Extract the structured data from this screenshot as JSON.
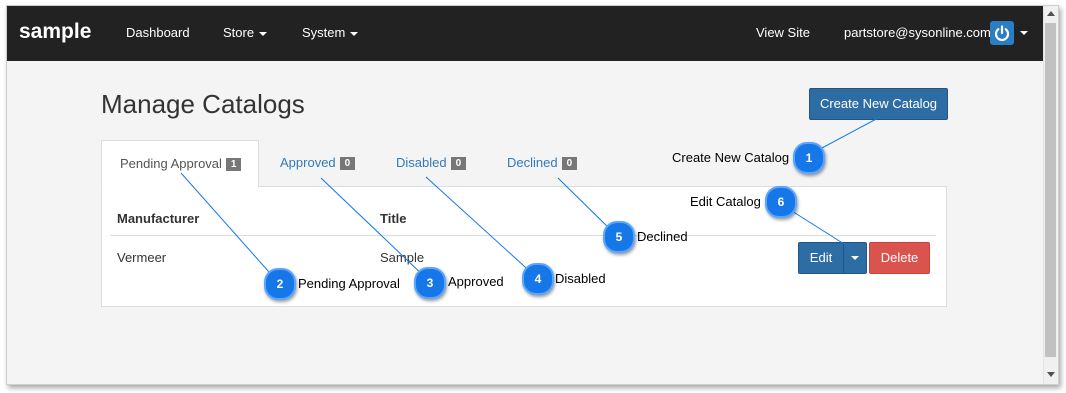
{
  "navbar": {
    "brand": "sample",
    "items": [
      {
        "label": "Dashboard"
      },
      {
        "label": "Store"
      },
      {
        "label": "System"
      }
    ],
    "view_site": "View Site",
    "user_email": "partstore@sysonline.com"
  },
  "page": {
    "title": "Manage Catalogs",
    "create_button": "Create New Catalog"
  },
  "tabs": [
    {
      "label": "Pending Approval",
      "count": "1"
    },
    {
      "label": "Approved",
      "count": "0"
    },
    {
      "label": "Disabled",
      "count": "0"
    },
    {
      "label": "Declined",
      "count": "0"
    }
  ],
  "table": {
    "columns": [
      "Manufacturer",
      "Title"
    ],
    "rows": [
      {
        "manufacturer": "Vermeer",
        "title": "Sample",
        "edit_label": "Edit",
        "delete_label": "Delete"
      }
    ]
  },
  "callouts": [
    {
      "number": "1",
      "text": "Create New Catalog"
    },
    {
      "number": "2",
      "text": "Pending Approval"
    },
    {
      "number": "3",
      "text": "Approved"
    },
    {
      "number": "4",
      "text": "Disabled"
    },
    {
      "number": "5",
      "text": "Declined"
    },
    {
      "number": "6",
      "text": "Edit Catalog"
    }
  ],
  "colors": {
    "navbar_bg": "#222222",
    "primary": "#2e6da4",
    "danger": "#d9534f",
    "link": "#337ab7",
    "badge": "#777777",
    "callout": "#1577e8"
  }
}
